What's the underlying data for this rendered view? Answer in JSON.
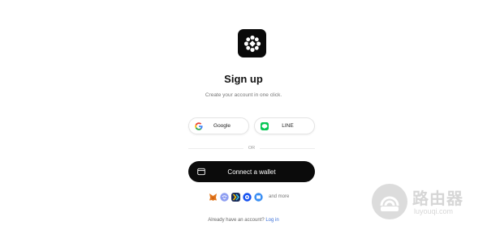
{
  "signup": {
    "title": "Sign up",
    "subtitle": "Create your account in one click."
  },
  "social": {
    "google_label": "Google",
    "line_label": "LINE"
  },
  "divider": {
    "text": "OR"
  },
  "wallet": {
    "connect_label": "Connect a wallet",
    "icons": [
      "metamask-icon",
      "walletconnect-icon",
      "bitget-icon",
      "coinbase-icon",
      "trust-icon"
    ],
    "more_text": "and more"
  },
  "login": {
    "prompt": "Already have an account?",
    "link": "Log in"
  },
  "watermark": {
    "cn": "路由器",
    "en": "luyouqi.com"
  },
  "colors": {
    "primary_button": "#0b0b0b",
    "link": "#3a6fd8",
    "line_green": "#06c755"
  }
}
